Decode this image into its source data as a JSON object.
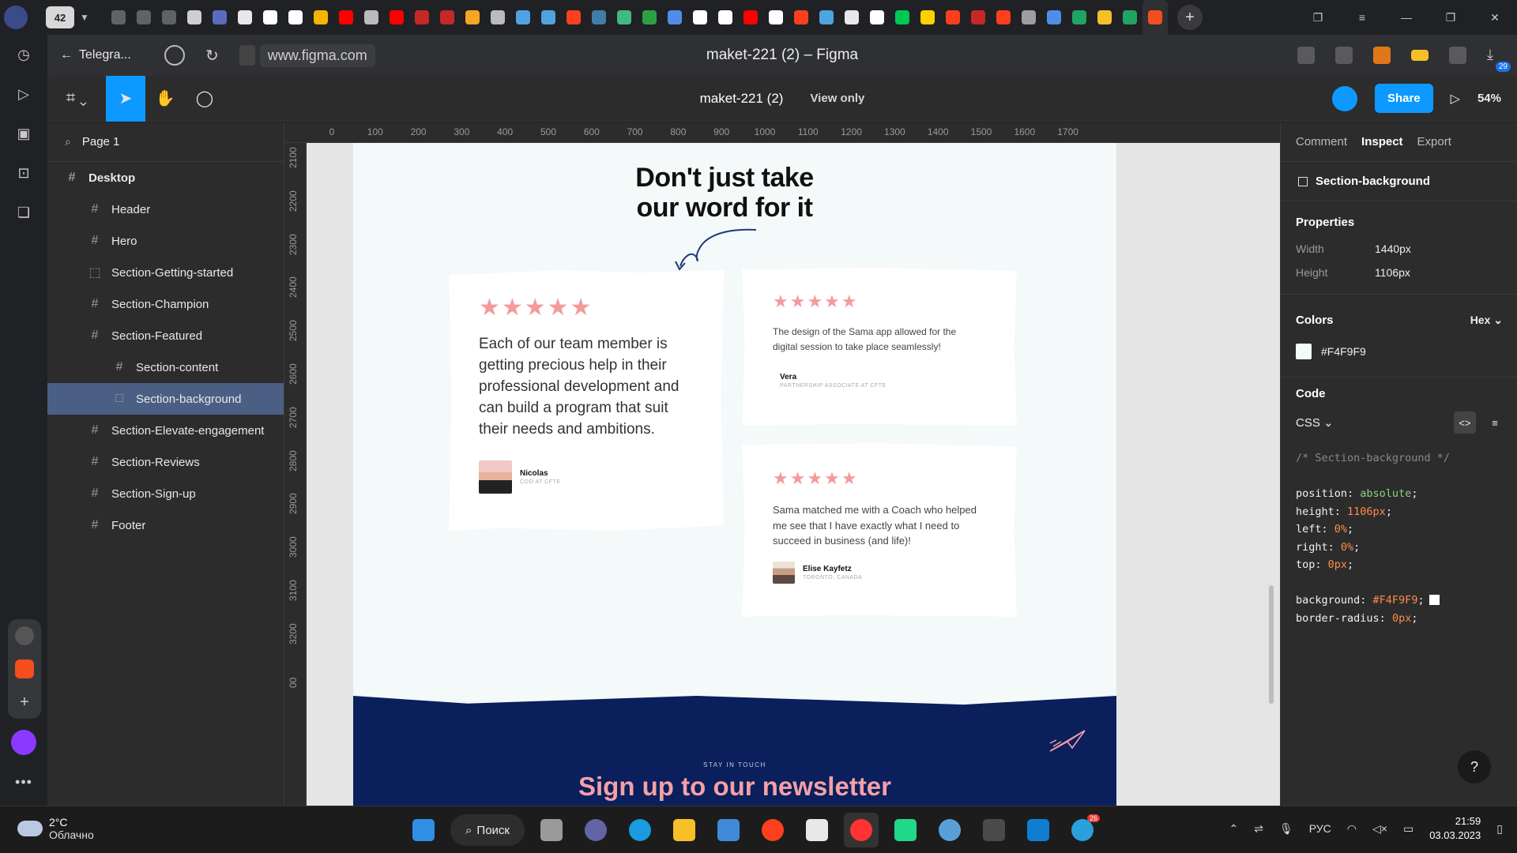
{
  "browser": {
    "tab_count": "42",
    "tab_icons": [
      {
        "name": "shield-tab-icon",
        "color": "#5f6368"
      },
      {
        "name": "shield-tab-icon",
        "color": "#5f6368"
      },
      {
        "name": "shield-tab-icon",
        "color": "#5f6368"
      },
      {
        "name": "chart-tab-icon",
        "color": "#cfcfcf"
      },
      {
        "name": "php-tab-icon",
        "color": "#5b6bbf"
      },
      {
        "name": "doc-tab-icon",
        "color": "#e8e8e8"
      },
      {
        "name": "notion-tab-icon",
        "color": "#ffffff"
      },
      {
        "name": "notion-tab-icon",
        "color": "#ffffff"
      },
      {
        "name": "fork-tab-icon",
        "color": "#f4b400"
      },
      {
        "name": "youtube-tab-icon",
        "color": "#ff0000"
      },
      {
        "name": "circle-tab-icon",
        "color": "#bbbbbb"
      },
      {
        "name": "youtube-tab-icon",
        "color": "#ff0000"
      },
      {
        "name": "figure-tab-icon",
        "color": "#c62828"
      },
      {
        "name": "figure-tab-icon",
        "color": "#c62828"
      },
      {
        "name": "bird-tab-icon",
        "color": "#f5a623"
      },
      {
        "name": "circle-tab-icon",
        "color": "#bbbbbb"
      },
      {
        "name": "t-tab-icon",
        "color": "#4fa3e0"
      },
      {
        "name": "t-tab-icon",
        "color": "#4fa3e0"
      },
      {
        "name": "yandex-tab-icon",
        "color": "#fc3f1d"
      },
      {
        "name": "elephant-tab-icon",
        "color": "#3e7ea8"
      },
      {
        "name": "v-tab-icon",
        "color": "#42b883"
      },
      {
        "name": "code-tab-icon",
        "color": "#2ea043"
      },
      {
        "name": "puzzle-tab-icon",
        "color": "#4f8de8"
      },
      {
        "name": "notion-tab-icon",
        "color": "#ffffff"
      },
      {
        "name": "notion-tab-icon",
        "color": "#ffffff"
      },
      {
        "name": "youtube-tab-icon",
        "color": "#ff0000"
      },
      {
        "name": "github-tab-icon",
        "color": "#ffffff"
      },
      {
        "name": "yandex-tab-icon",
        "color": "#fc3f1d"
      },
      {
        "name": "t-tab-icon",
        "color": "#4fa3e0"
      },
      {
        "name": "doc-tab-icon",
        "color": "#e8e8e8"
      },
      {
        "name": "github-tab-icon",
        "color": "#ffffff"
      },
      {
        "name": "play-tab-icon",
        "color": "#00c853"
      },
      {
        "name": "bee-tab-icon",
        "color": "#ffd000"
      },
      {
        "name": "yandex-tab-icon",
        "color": "#fc3f1d"
      },
      {
        "name": "figure-tab-icon",
        "color": "#c62828"
      },
      {
        "name": "yandex-tab-icon",
        "color": "#fc3f1d"
      },
      {
        "name": "gear-tab-icon",
        "color": "#9e9e9e"
      },
      {
        "name": "globe-tab-icon",
        "color": "#4f8de8"
      },
      {
        "name": "plus-green-tab-icon",
        "color": "#1fa463"
      },
      {
        "name": "folder-tab-icon",
        "color": "#f6c026"
      },
      {
        "name": "plus-green-tab-icon",
        "color": "#1fa463"
      },
      {
        "name": "figma-tab-icon",
        "color": "#f24e1e"
      }
    ],
    "back_label": "Telegra...",
    "url": "www.figma.com",
    "page_title": "maket-221 (2) – Figma",
    "downloads_badge": "29"
  },
  "figma": {
    "file_name": "maket-221 (2)",
    "mode": "View only",
    "share_label": "Share",
    "zoom": "54%",
    "page_selector": "Page 1"
  },
  "layers": [
    {
      "label": "Desktop",
      "icon": "#",
      "level": 0,
      "selected": false
    },
    {
      "label": "Header",
      "icon": "#",
      "level": 1,
      "selected": false
    },
    {
      "label": "Hero",
      "icon": "#",
      "level": 1,
      "selected": false
    },
    {
      "label": "Section-Getting-started",
      "icon": "⬚",
      "level": 1,
      "selected": false
    },
    {
      "label": "Section-Champion",
      "icon": "#",
      "level": 1,
      "selected": false
    },
    {
      "label": "Section-Featured",
      "icon": "#",
      "level": 1,
      "selected": false
    },
    {
      "label": "Section-content",
      "icon": "#",
      "level": 2,
      "selected": false
    },
    {
      "label": "Section-background",
      "icon": "□",
      "level": 2,
      "selected": true
    },
    {
      "label": "Section-Elevate-engagement",
      "icon": "#",
      "level": 1,
      "selected": false
    },
    {
      "label": "Section-Reviews",
      "icon": "#",
      "level": 1,
      "selected": false
    },
    {
      "label": "Section-Sign-up",
      "icon": "#",
      "level": 1,
      "selected": false
    },
    {
      "label": "Footer",
      "icon": "#",
      "level": 1,
      "selected": false
    }
  ],
  "ruler": {
    "top": [
      "0",
      "100",
      "200",
      "300",
      "400",
      "500",
      "600",
      "700",
      "800",
      "900",
      "1000",
      "1100",
      "1200",
      "1300",
      "1400",
      "1500",
      "1600",
      "1700"
    ],
    "left": [
      "2100",
      "2200",
      "2300",
      "2400",
      "2500",
      "2600",
      "2700",
      "2800",
      "2900",
      "3000",
      "3100",
      "3200",
      "00"
    ]
  },
  "design": {
    "heading": "Don't just take our word for it",
    "reviews": [
      {
        "stars": "★★★★★",
        "quote": "Each of our team member is getting precious help in their professional development and can build a program that suit their needs and ambitions.",
        "name": "Nicolas",
        "role": "COO AT CFTE"
      },
      {
        "stars": "★★★★★",
        "quote": "The design of the Sama app allowed for the digital session to take place seamlessly!",
        "name": "Vera",
        "role": "PARTNERSHIP ASSOCIATE AT CFTE"
      },
      {
        "stars": "★★★★★",
        "quote": "Sama matched me with a Coach who helped me see that I have exactly what I need to succeed in business (and life)!",
        "name": "Elise Kayfetz",
        "role": "TORONTO, CANADA"
      }
    ],
    "newsletter_kicker": "STAY IN TOUCH",
    "newsletter_title": "Sign up to our newsletter",
    "colors": {
      "section_bg": "#F4F9F9",
      "newsletter_bg": "#0a1f5c",
      "star": "#f49a9a",
      "title_pink": "#f4a0a6"
    }
  },
  "inspect": {
    "tabs": [
      "Comment",
      "Inspect",
      "Export"
    ],
    "active_tab": "Inspect",
    "selected_layer": "Section-background",
    "properties_title": "Properties",
    "width_label": "Width",
    "width_value": "1440px",
    "height_label": "Height",
    "height_value": "1106px",
    "colors_title": "Colors",
    "color_format": "Hex",
    "color_value": "#F4F9F9",
    "code_title": "Code",
    "code_lang": "CSS",
    "code_comment": "/* Section-background */",
    "code_lines": [
      {
        "prop": "position",
        "val": "absolute",
        "type": "kw"
      },
      {
        "prop": "height",
        "val": "1106px",
        "type": "num"
      },
      {
        "prop": "left",
        "val": "0%",
        "type": "num"
      },
      {
        "prop": "right",
        "val": "0%",
        "type": "num"
      },
      {
        "prop": "top",
        "val": "0px",
        "type": "num"
      },
      {
        "prop": "",
        "val": "",
        "type": "blank"
      },
      {
        "prop": "background",
        "val": "#F4F9F9",
        "type": "num",
        "swatch": true
      },
      {
        "prop": "border-radius",
        "val": "0px",
        "type": "num"
      }
    ]
  },
  "taskbar": {
    "temperature": "2°C",
    "weather": "Облачно",
    "search_label": "Поиск",
    "language": "РУС",
    "time": "21:59",
    "date": "03.03.2023",
    "telegram_badge": "26"
  }
}
